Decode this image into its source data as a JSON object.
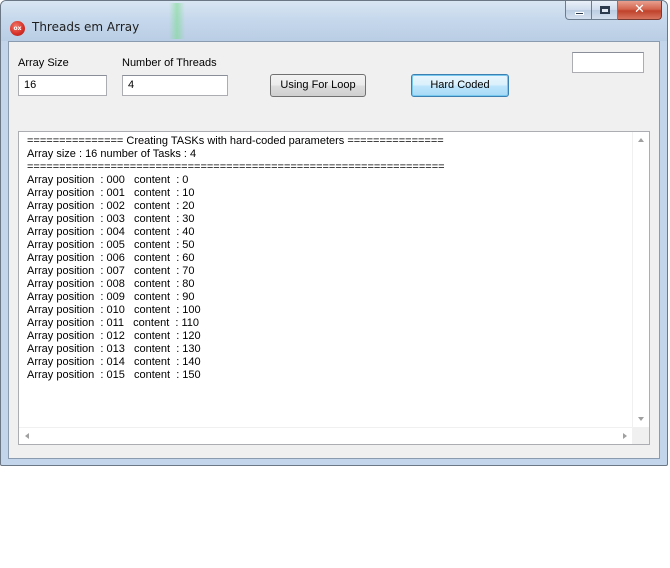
{
  "window": {
    "title": "Threads em Array",
    "app_icon_text": "ox"
  },
  "caption": {
    "close_glyph": "✕"
  },
  "form": {
    "array_size_label": "Array Size",
    "array_size_value": "16",
    "threads_label": "Number of  Threads",
    "threads_value": "4",
    "top_right_value": "",
    "loop_button_label": "Using For Loop",
    "hardcoded_button_label": "Hard Coded"
  },
  "output": {
    "lines": [
      "=============== Creating TASKs with hard-coded parameters ===============",
      "Array size : 16 number of Tasks : 4",
      "=================================================================",
      "Array position  : 000   content  : 0",
      "Array position  : 001   content  : 10",
      "Array position  : 002   content  : 20",
      "Array position  : 003   content  : 30",
      "Array position  : 004   content  : 40",
      "Array position  : 005   content  : 50",
      "Array position  : 006   content  : 60",
      "Array position  : 007   content  : 70",
      "Array position  : 008   content  : 80",
      "Array position  : 009   content  : 90",
      "Array position  : 010   content  : 100",
      "Array position  : 011   content  : 110",
      "Array position  : 012   content  : 120",
      "Array position  : 013   content  : 130",
      "Array position  : 014   content  : 140",
      "Array position  : 015   content  : 150"
    ]
  }
}
